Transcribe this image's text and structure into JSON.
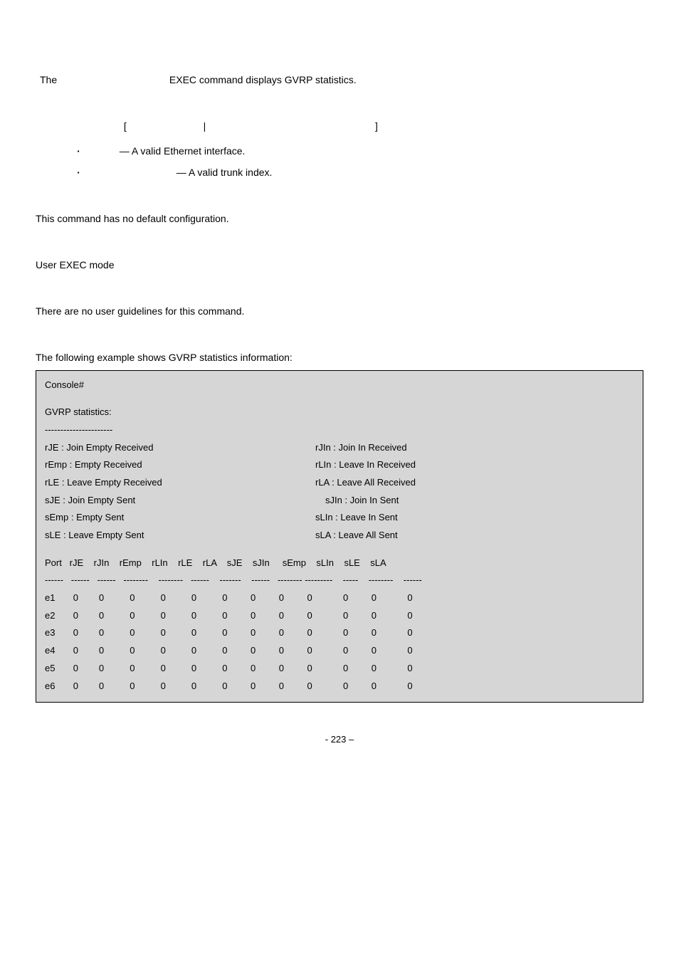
{
  "intro": {
    "pre": "The ",
    "post": "EXEC command displays GVRP statistics."
  },
  "syntax": {
    "lb": "[",
    "sep": "|",
    "rb": "]"
  },
  "bullets": {
    "b1": "— A valid Ethernet interface.",
    "b2": "— A valid trunk index."
  },
  "default_cfg": "This command has no default configuration.",
  "cmd_mode": "User EXEC mode",
  "guidelines": "There are no user guidelines for this command.",
  "example_intro": "The following example shows GVRP statistics information:",
  "console": {
    "prompt": "Console#",
    "title": "GVRP statistics:",
    "title_sep": "----------------------",
    "legend": [
      {
        "l": "rJE : Join Empty Received",
        "r": "rJIn : Join In Received"
      },
      {
        "l": "rEmp : Empty Received",
        "r": "rLIn : Leave In Received"
      },
      {
        "l": "rLE : Leave Empty Received",
        "r": "rLA : Leave All Received"
      },
      {
        "l": "sJE : Join Empty Sent",
        "r": "sJIn : Join In Sent"
      },
      {
        "l": "sEmp : Empty Sent",
        "r": "sLIn : Leave In Sent"
      },
      {
        "l": "sLE : Leave Empty Sent",
        "r": "sLA : Leave All Sent"
      }
    ],
    "header_line": "Port   rJE    rJIn    rEmp    rLIn    rLE    rLA    sJE    sJIn     sEmp    sLIn    sLE    sLA",
    "sep_line": "------   ------   ------   --------    --------   ------    -------    ------   -------- ---------    -----    --------    ------",
    "rows": [
      "e1       0        0          0          0          0          0         0         0         0            0         0            0",
      "e2       0        0          0          0          0          0         0         0         0            0         0            0",
      "e3       0        0          0          0          0          0         0         0         0            0         0            0",
      "e4       0        0          0          0          0          0         0         0         0            0         0            0",
      "e5       0        0          0          0          0          0         0         0         0            0         0            0",
      "e6       0        0          0          0          0          0         0         0         0            0         0            0"
    ]
  },
  "chart_data": {
    "type": "table",
    "title": "GVRP statistics",
    "columns": [
      "Port",
      "rJE",
      "rJIn",
      "rEmp",
      "rLIn",
      "rLE",
      "rLA",
      "sJE",
      "sJIn",
      "sEmp",
      "sLIn",
      "sLE",
      "sLA"
    ],
    "rows": [
      [
        "e1",
        0,
        0,
        0,
        0,
        0,
        0,
        0,
        0,
        0,
        0,
        0,
        0
      ],
      [
        "e2",
        0,
        0,
        0,
        0,
        0,
        0,
        0,
        0,
        0,
        0,
        0,
        0
      ],
      [
        "e3",
        0,
        0,
        0,
        0,
        0,
        0,
        0,
        0,
        0,
        0,
        0,
        0
      ],
      [
        "e4",
        0,
        0,
        0,
        0,
        0,
        0,
        0,
        0,
        0,
        0,
        0,
        0
      ],
      [
        "e5",
        0,
        0,
        0,
        0,
        0,
        0,
        0,
        0,
        0,
        0,
        0,
        0
      ],
      [
        "e6",
        0,
        0,
        0,
        0,
        0,
        0,
        0,
        0,
        0,
        0,
        0,
        0
      ]
    ]
  },
  "footer": "- 223 –"
}
